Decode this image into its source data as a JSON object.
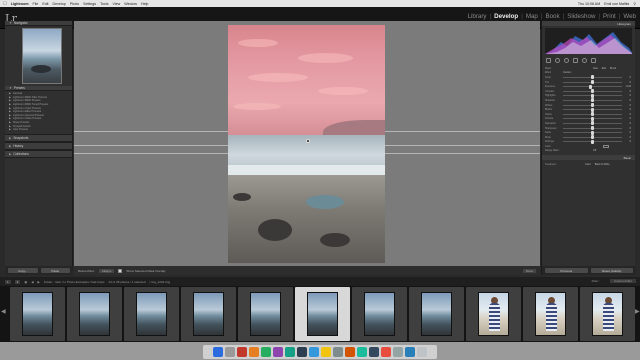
{
  "menubar": {
    "app": "Lightroom",
    "items": [
      "File",
      "Edit",
      "Develop",
      "Photo",
      "Settings",
      "Tools",
      "View",
      "Window",
      "Help"
    ],
    "clock": "Thu 10:08 AM",
    "user": "Emil von Maltitz"
  },
  "header": {
    "logo": "Lr",
    "modules": [
      "Library",
      "Develop",
      "Map",
      "Book",
      "Slideshow",
      "Print",
      "Web"
    ],
    "active_module": "Develop"
  },
  "left_panel": {
    "navigator_title": "Navigator",
    "presets_title": "Presets",
    "presets": [
      "General",
      "Lightroom B&W Filter Presets",
      "Lightroom B&W Presets",
      "Lightroom B&W Toned Presets",
      "Lightroom Color Presets",
      "Lightroom Effect Presets",
      "Lightroom General Presets",
      "Lightroom Video Presets",
      "Sharp Presets",
      "Texspell Artistic",
      "User Presets"
    ],
    "snapshots_title": "Snapshots",
    "history_title": "History",
    "collections_title": "Collections",
    "copy_button": "Copy...",
    "paste_button": "Paste"
  },
  "toolbar": {
    "before_after_label": "Before/After:",
    "before_after_value": "Always",
    "show_label": "Show Selected Mask Overlay",
    "done_button": "Done"
  },
  "right_panel": {
    "histogram_title": "Histogram",
    "mask_label": "Mask :",
    "mask_modes": [
      "New",
      "Edit",
      "Brush"
    ],
    "effect_label": "Effect :",
    "effect_value": "Custom",
    "sliders": [
      {
        "label": "Temp",
        "value": "0",
        "pos": 0.5
      },
      {
        "label": "Tint",
        "value": "0",
        "pos": 0.5
      },
      {
        "label": "Exposure",
        "value": "-0.23",
        "pos": 0.46
      },
      {
        "label": "Contrast",
        "value": "0",
        "pos": 0.5
      },
      {
        "label": "Highlights",
        "value": "0",
        "pos": 0.5
      },
      {
        "label": "Shadows",
        "value": "0",
        "pos": 0.5
      },
      {
        "label": "Whites",
        "value": "0",
        "pos": 0.5
      },
      {
        "label": "Blacks",
        "value": "0",
        "pos": 0.5
      },
      {
        "label": "Clarity",
        "value": "0",
        "pos": 0.5
      },
      {
        "label": "Dehaze",
        "value": "0",
        "pos": 0.5
      },
      {
        "label": "Saturation",
        "value": "0",
        "pos": 0.5
      },
      {
        "label": "Sharpness",
        "value": "0",
        "pos": 0.5
      },
      {
        "label": "Noise",
        "value": "0",
        "pos": 0.5
      },
      {
        "label": "Moire",
        "value": "0",
        "pos": 0.5
      },
      {
        "label": "Defringe",
        "value": "0",
        "pos": 0.5
      }
    ],
    "color_label": "Color",
    "range_mask_label": "Range Mask :",
    "range_mask_value": "Off",
    "basic_title": "Basic",
    "treatment_label": "Treatment :",
    "treatment_modes": [
      "Color",
      "Black & White"
    ],
    "previous_button": "Previous",
    "reset_button": "Reset (Adobe)"
  },
  "filmstrip": {
    "monitor_1": "1",
    "monitor_2": "2",
    "path": "Folder : misc / Lr Photo Examples / bad crops",
    "count": "13 of 38 photos / 1 selected",
    "filename": "/ img_1234.dng",
    "filter_label": "Filter :",
    "filter_value": "Custom Filter",
    "thumbnails": [
      {
        "kind": "seascape",
        "selected": false
      },
      {
        "kind": "seascape",
        "selected": false
      },
      {
        "kind": "seascape",
        "selected": false
      },
      {
        "kind": "seascape",
        "selected": false
      },
      {
        "kind": "seascape",
        "selected": false
      },
      {
        "kind": "seascape",
        "selected": true
      },
      {
        "kind": "seascape",
        "selected": false
      },
      {
        "kind": "seascape",
        "selected": false
      },
      {
        "kind": "portrait",
        "selected": false
      },
      {
        "kind": "portrait",
        "selected": false
      },
      {
        "kind": "portrait",
        "selected": false
      }
    ]
  },
  "dock": {
    "icon_colors": [
      "#2d6cdf",
      "#9a9a9a",
      "#c0392b",
      "#e67e22",
      "#27ae60",
      "#8e44ad",
      "#16a085",
      "#2c3e50",
      "#3498db",
      "#f1c40f",
      "#7f8c8d",
      "#d35400",
      "#1abc9c",
      "#34495e",
      "#e74c3c",
      "#95a5a6",
      "#2980b9",
      "#bdc3c7"
    ]
  }
}
